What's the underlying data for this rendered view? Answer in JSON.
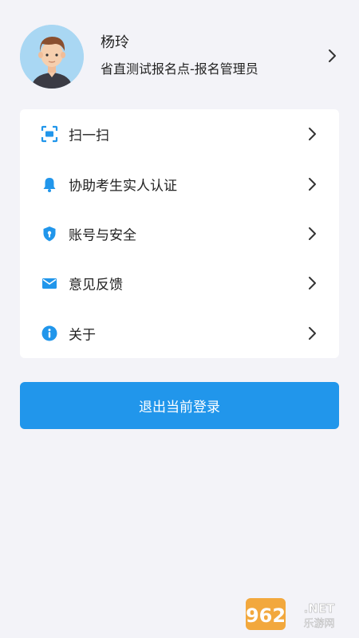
{
  "profile": {
    "name": "杨玲",
    "role": "省直测试报名点-报名管理员"
  },
  "menu": {
    "items": [
      {
        "label": "扫一扫",
        "icon": "scan-icon"
      },
      {
        "label": "协助考生实人认证",
        "icon": "bell-icon"
      },
      {
        "label": "账号与安全",
        "icon": "shield-icon"
      },
      {
        "label": "意见反馈",
        "icon": "mail-icon"
      },
      {
        "label": "关于",
        "icon": "info-icon"
      }
    ]
  },
  "logout": {
    "label": "退出当前登录"
  },
  "watermark": {
    "brand": "962.NET",
    "subtitle": "乐游网"
  },
  "colors": {
    "accent": "#2196eb",
    "background": "#f3f3f8",
    "card": "#ffffff",
    "text": "#222222"
  }
}
